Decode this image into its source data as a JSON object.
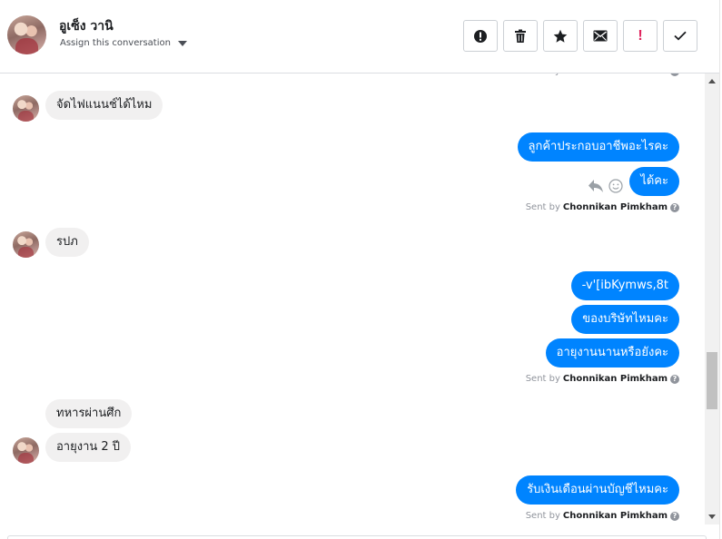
{
  "header": {
    "contact_name": "อูเซ็ง วานิ",
    "assign_label": "Assign this conversation",
    "actions": [
      {
        "name": "spam-button",
        "icon": "exclamation-circle-icon"
      },
      {
        "name": "delete-button",
        "icon": "trash-icon"
      },
      {
        "name": "star-button",
        "icon": "star-icon"
      },
      {
        "name": "mark-unread-button",
        "icon": "envelope-icon"
      },
      {
        "name": "follow-up-button",
        "icon": "exclamation-icon"
      },
      {
        "name": "mark-done-button",
        "icon": "check-icon"
      }
    ]
  },
  "colors": {
    "outgoing_bubble": "#0084ff",
    "incoming_bubble": "#f1f0f0",
    "follow_up_red": "#e0245e"
  },
  "conversation": {
    "sent_by_prefix": "Sent by",
    "sender_name": "Chonnikan Pimkham",
    "help_glyph": "?",
    "messages": [
      {
        "direction": "in",
        "text": "จัดไฟแนนช์ได้ไหม"
      },
      {
        "direction": "out",
        "text": "ลูกค้าประกอบอาชีพอะไรคะ"
      },
      {
        "direction": "out",
        "text": "ได้คะ"
      },
      {
        "direction": "in",
        "text": "รปภ"
      },
      {
        "direction": "out",
        "text": "-v'[ibKymws,8t"
      },
      {
        "direction": "out",
        "text": "ของบริษัทไหมคะ"
      },
      {
        "direction": "out",
        "text": "อายุงานนานหรือยังคะ"
      },
      {
        "direction": "in",
        "text": "ทหารผ่านศึก"
      },
      {
        "direction": "in",
        "text": "อายุงาน 2 ปี"
      },
      {
        "direction": "out",
        "text": "รับเงินเดือนผ่านบัญชีไหมคะ"
      }
    ]
  }
}
